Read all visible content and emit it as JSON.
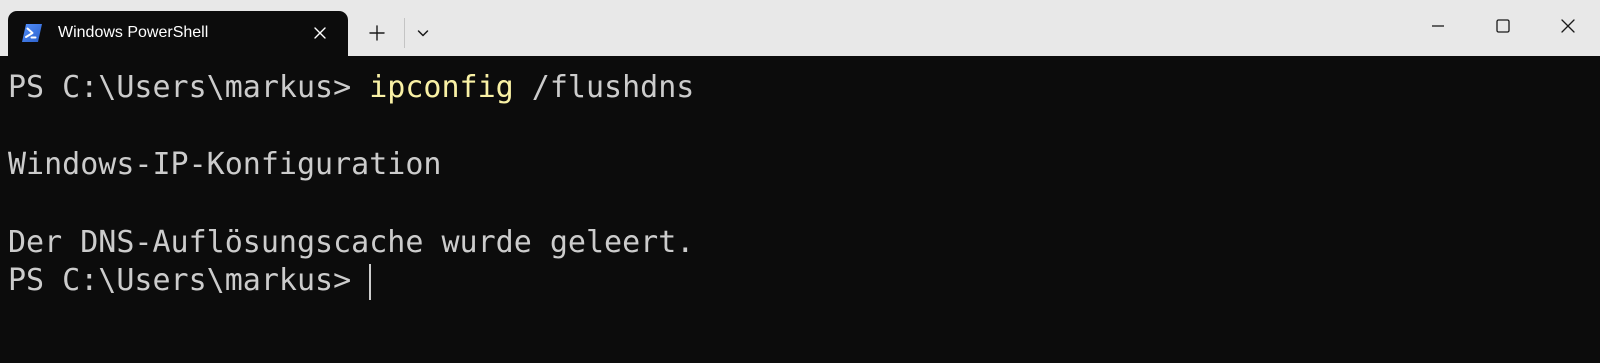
{
  "tab": {
    "title": "Windows PowerShell",
    "icon": "powershell-icon"
  },
  "tabstrip": {
    "new_tab_icon": "plus-icon",
    "dropdown_icon": "chevron-down-icon"
  },
  "window_controls": {
    "minimize_icon": "minimize-icon",
    "maximize_icon": "maximize-icon",
    "close_icon": "close-icon"
  },
  "terminal": {
    "line1_prompt": "PS C:\\Users\\markus> ",
    "line1_command": "ipconfig",
    "line1_args": " /flushdns",
    "line2": "Windows-IP-Konfiguration",
    "line3": "Der DNS-Auflösungscache wurde geleert.",
    "line4_prompt": "PS C:\\Users\\markus> "
  },
  "colors": {
    "background": "#0c0c0c",
    "foreground": "#cccccc",
    "command": "#f9f1a5",
    "titlebar": "#e8e8e8"
  }
}
